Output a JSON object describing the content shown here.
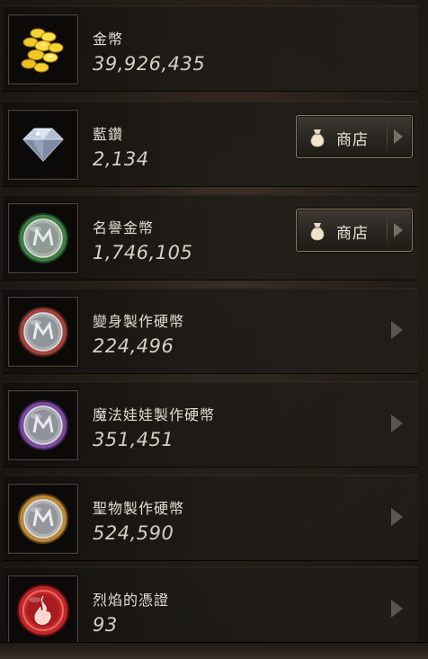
{
  "currencies": [
    {
      "name": "金幣",
      "amount": "39,926,435",
      "icon": "gold-coins-icon"
    },
    {
      "name": "藍鑽",
      "amount": "2,134",
      "icon": "blue-diamond-icon",
      "shop_label": "商店"
    },
    {
      "name": "名譽金幣",
      "amount": "1,746,105",
      "icon": "green-honor-coin-icon",
      "shop_label": "商店"
    },
    {
      "name": "變身製作硬幣",
      "amount": "224,496",
      "icon": "red-transform-coin-icon"
    },
    {
      "name": "魔法娃娃製作硬幣",
      "amount": "351,451",
      "icon": "purple-doll-coin-icon"
    },
    {
      "name": "聖物製作硬幣",
      "amount": "524,590",
      "icon": "gold-relic-coin-icon"
    },
    {
      "name": "烈焰的憑證",
      "amount": "93",
      "icon": "flame-token-icon"
    }
  ],
  "colors": {
    "coin_green": "#3f7e44",
    "coin_red": "#a0443c",
    "coin_purple": "#7a4a9c",
    "coin_gold": "#b9893a",
    "flame_red": "#c0262a",
    "shop_border": "#8b7b61"
  }
}
